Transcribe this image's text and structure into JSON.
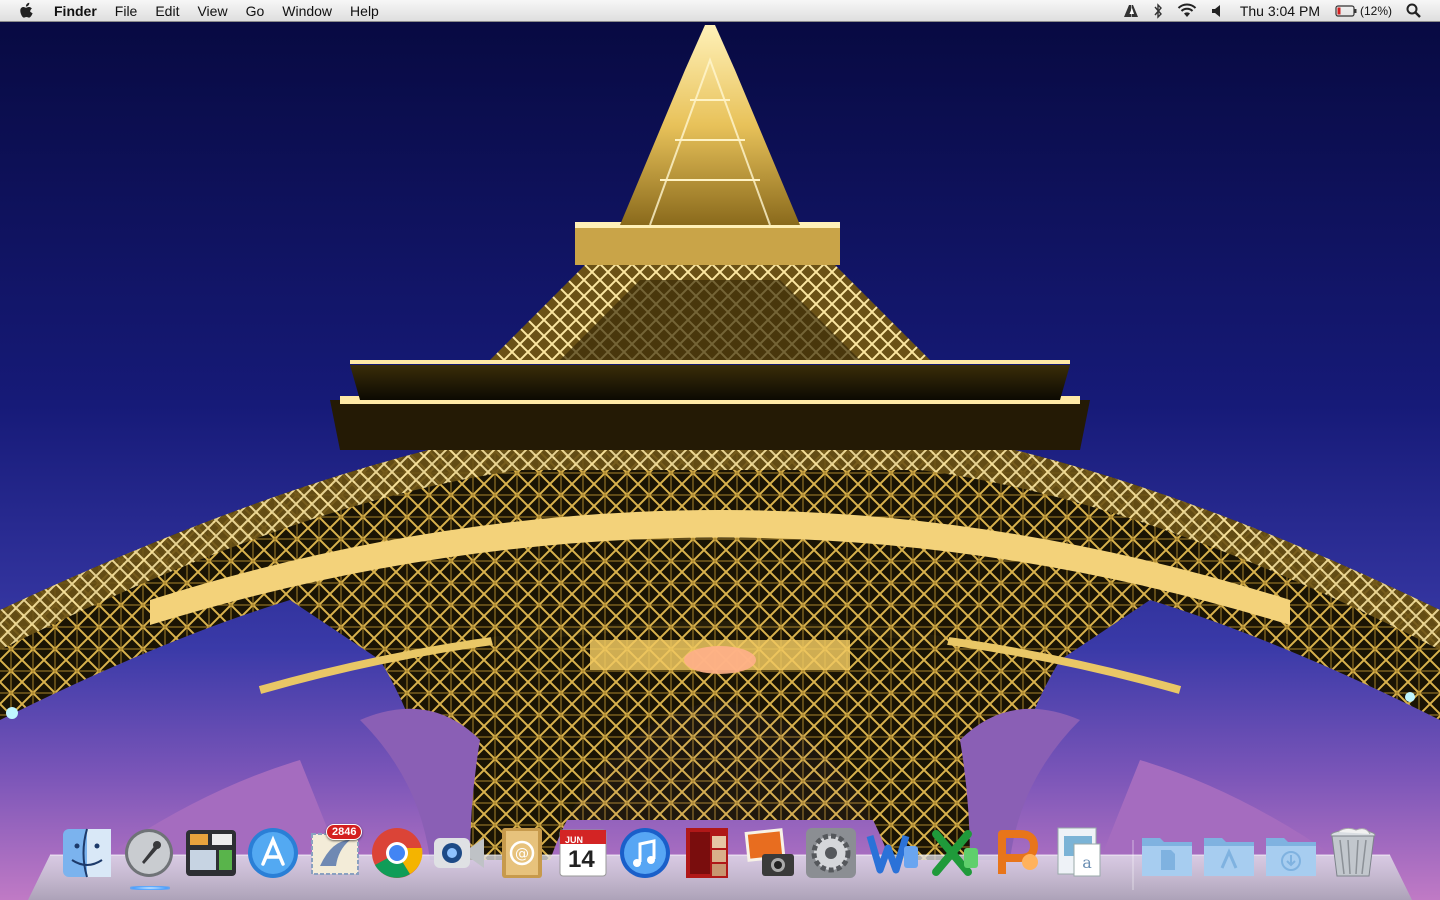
{
  "menubar": {
    "app_name": "Finder",
    "menus": [
      "File",
      "Edit",
      "View",
      "Go",
      "Window",
      "Help"
    ],
    "clock": "Thu 3:04 PM",
    "battery_percent": "(12%)",
    "status_icons": [
      "adobe-icon",
      "bluetooth-icon",
      "wifi-icon",
      "volume-icon",
      "battery-icon",
      "spotlight-icon"
    ]
  },
  "dock": {
    "apps": [
      {
        "name": "Finder",
        "icon": "finder-icon"
      },
      {
        "name": "Launchpad",
        "icon": "launchpad-icon",
        "running": true
      },
      {
        "name": "Mission Control",
        "icon": "mission-control-icon"
      },
      {
        "name": "App Store",
        "icon": "app-store-icon"
      },
      {
        "name": "Mail",
        "icon": "mail-icon",
        "badge": "2846"
      },
      {
        "name": "Google Chrome",
        "icon": "chrome-icon"
      },
      {
        "name": "FaceTime",
        "icon": "facetime-icon"
      },
      {
        "name": "Address Book",
        "icon": "address-book-icon"
      },
      {
        "name": "iCal",
        "icon": "calendar-icon",
        "month": "JUN",
        "day": "14"
      },
      {
        "name": "iTunes",
        "icon": "itunes-icon"
      },
      {
        "name": "Photo Booth",
        "icon": "photo-booth-icon"
      },
      {
        "name": "iPhoto",
        "icon": "iphoto-icon"
      },
      {
        "name": "System Preferences",
        "icon": "system-preferences-icon"
      },
      {
        "name": "Microsoft Word",
        "icon": "word-icon"
      },
      {
        "name": "Microsoft Excel",
        "icon": "excel-icon"
      },
      {
        "name": "Microsoft PowerPoint",
        "icon": "powerpoint-icon"
      },
      {
        "name": "Preview",
        "icon": "preview-icon"
      }
    ],
    "folders": [
      {
        "name": "Documents",
        "icon": "documents-folder-icon"
      },
      {
        "name": "Applications",
        "icon": "applications-folder-icon"
      },
      {
        "name": "Downloads",
        "icon": "downloads-folder-icon"
      },
      {
        "name": "Trash",
        "icon": "trash-icon"
      }
    ]
  },
  "colors": {
    "sky_top": "#0b0d52",
    "sky_bottom": "#b56fc0",
    "tower_light": "#f6d77a",
    "menubar": "#efefef"
  }
}
